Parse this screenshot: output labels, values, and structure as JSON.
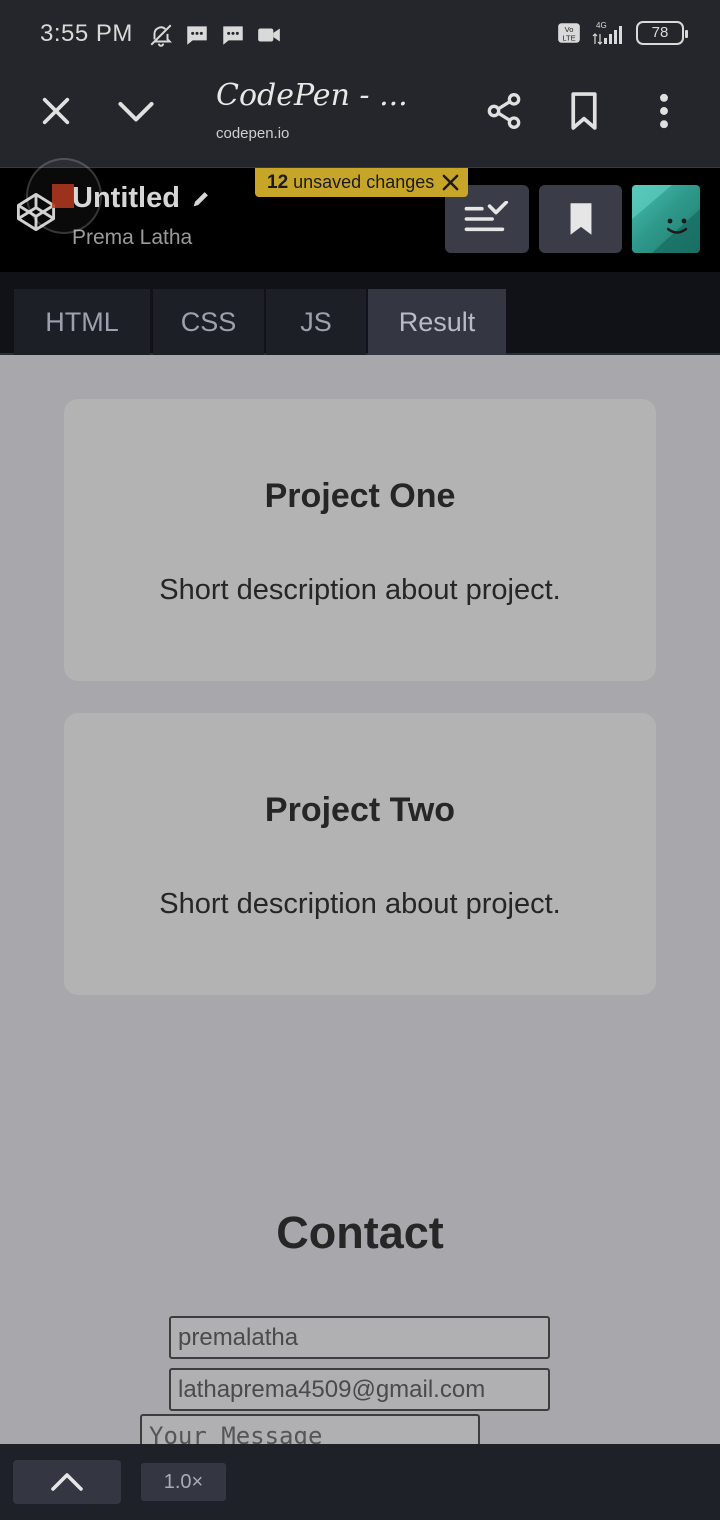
{
  "status_bar": {
    "time": "3:55 PM",
    "battery": "78",
    "network": "4G",
    "volte": "Vo LTE"
  },
  "browser": {
    "title": "CodePen - ...",
    "url": "codepen.io"
  },
  "codepen": {
    "pen_title": "Untitled",
    "author": "Prema Latha",
    "unsaved_count": "12",
    "unsaved_text": " unsaved changes"
  },
  "tabs": [
    {
      "label": "HTML"
    },
    {
      "label": "CSS"
    },
    {
      "label": "JS"
    },
    {
      "label": "Result"
    }
  ],
  "result": {
    "projects": [
      {
        "title": "Project One",
        "description": "Short description about project."
      },
      {
        "title": "Project Two",
        "description": "Short description about project."
      }
    ],
    "contact": {
      "heading": "Contact",
      "name_value": "premalatha",
      "email_value": "lathaprema4509@gmail.com",
      "message_placeholder": "Your Message"
    }
  },
  "bottom_bar": {
    "zoom": "1.0×"
  },
  "colors": {
    "unsaved_badge": "#c7a528",
    "header_bg": "#000000",
    "result_bg": "#a8a8ac"
  }
}
